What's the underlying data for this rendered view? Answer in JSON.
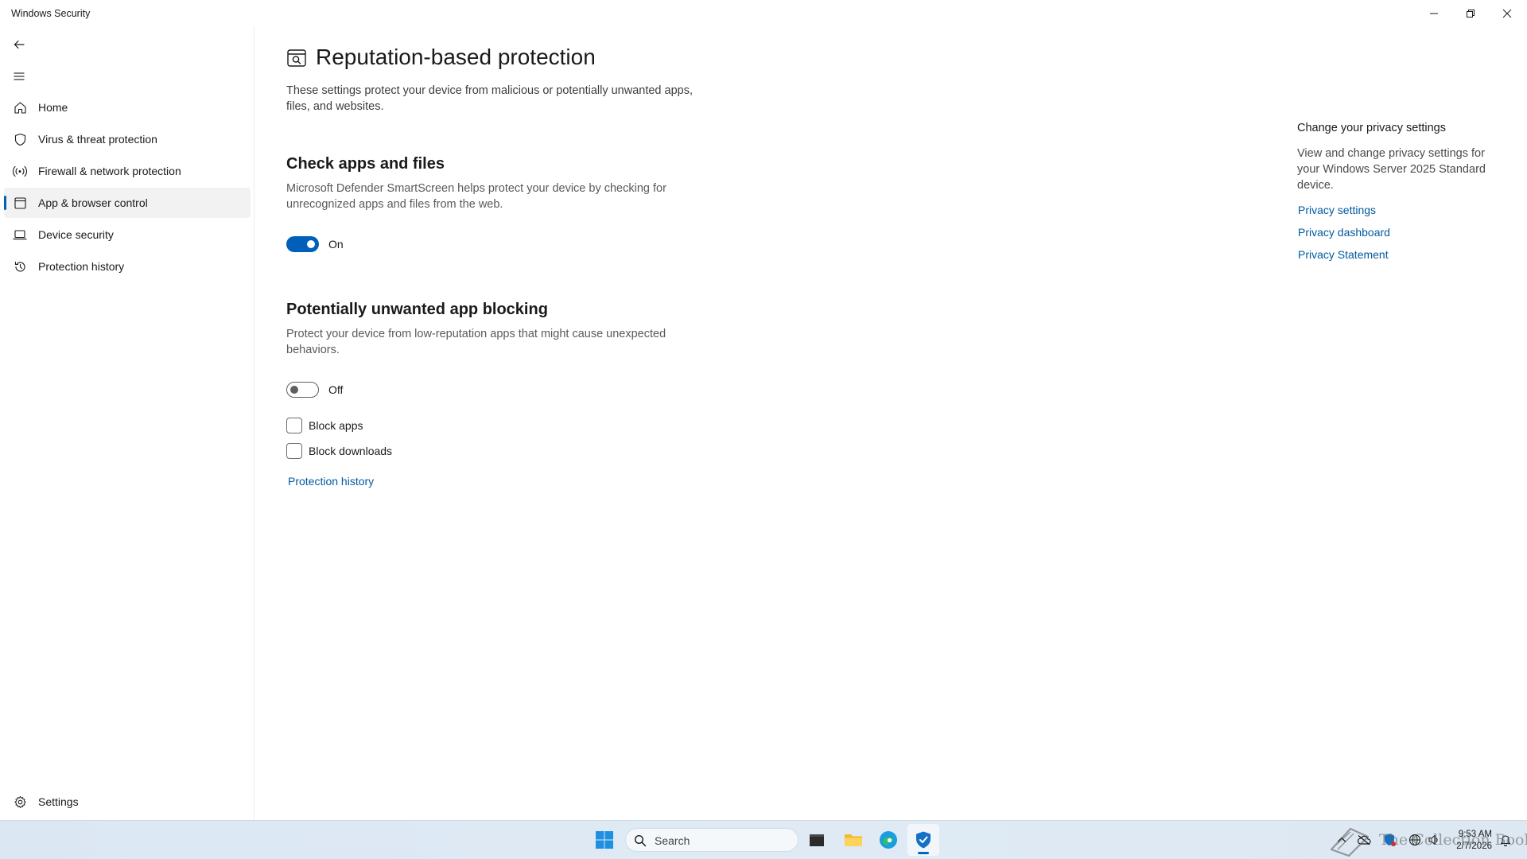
{
  "window": {
    "title": "Windows Security"
  },
  "sidebar": {
    "items": [
      {
        "label": "Home",
        "icon": "home-icon"
      },
      {
        "label": "Virus & threat protection",
        "icon": "shield-icon"
      },
      {
        "label": "Firewall & network protection",
        "icon": "wifi-antenna-icon"
      },
      {
        "label": "App & browser control",
        "icon": "app-window-icon",
        "active": true
      },
      {
        "label": "Device security",
        "icon": "laptop-icon"
      },
      {
        "label": "Protection history",
        "icon": "history-icon"
      }
    ],
    "settings_label": "Settings"
  },
  "main": {
    "title": "Reputation-based protection",
    "description": "These settings protect your device from malicious or potentially unwanted apps, files, and websites.",
    "check_apps": {
      "title": "Check apps and files",
      "description": "Microsoft Defender SmartScreen helps protect your device by checking for unrecognized apps and files from the web.",
      "toggle_state": "On",
      "enabled": true
    },
    "pua": {
      "title": "Potentially unwanted app blocking",
      "description": "Protect your device from low-reputation apps that might cause unexpected behaviors.",
      "toggle_state": "Off",
      "enabled": false,
      "block_apps_label": "Block apps",
      "block_apps_checked": false,
      "block_downloads_label": "Block downloads",
      "block_downloads_checked": false,
      "history_link": "Protection history"
    }
  },
  "privacy_panel": {
    "title": "Change your privacy settings",
    "description": "View and change privacy settings for your Windows Server 2025 Standard device.",
    "links": [
      "Privacy settings",
      "Privacy dashboard",
      "Privacy Statement"
    ]
  },
  "taskbar": {
    "search_placeholder": "Search",
    "time": "9:53 AM",
    "date": "2/7/2026",
    "watermark": "The Collection Book",
    "accent_color": "#0067c0"
  },
  "colors": {
    "accent": "#005fb8",
    "link": "#005a9e",
    "active_nav_bg": "#f2f2f2"
  }
}
